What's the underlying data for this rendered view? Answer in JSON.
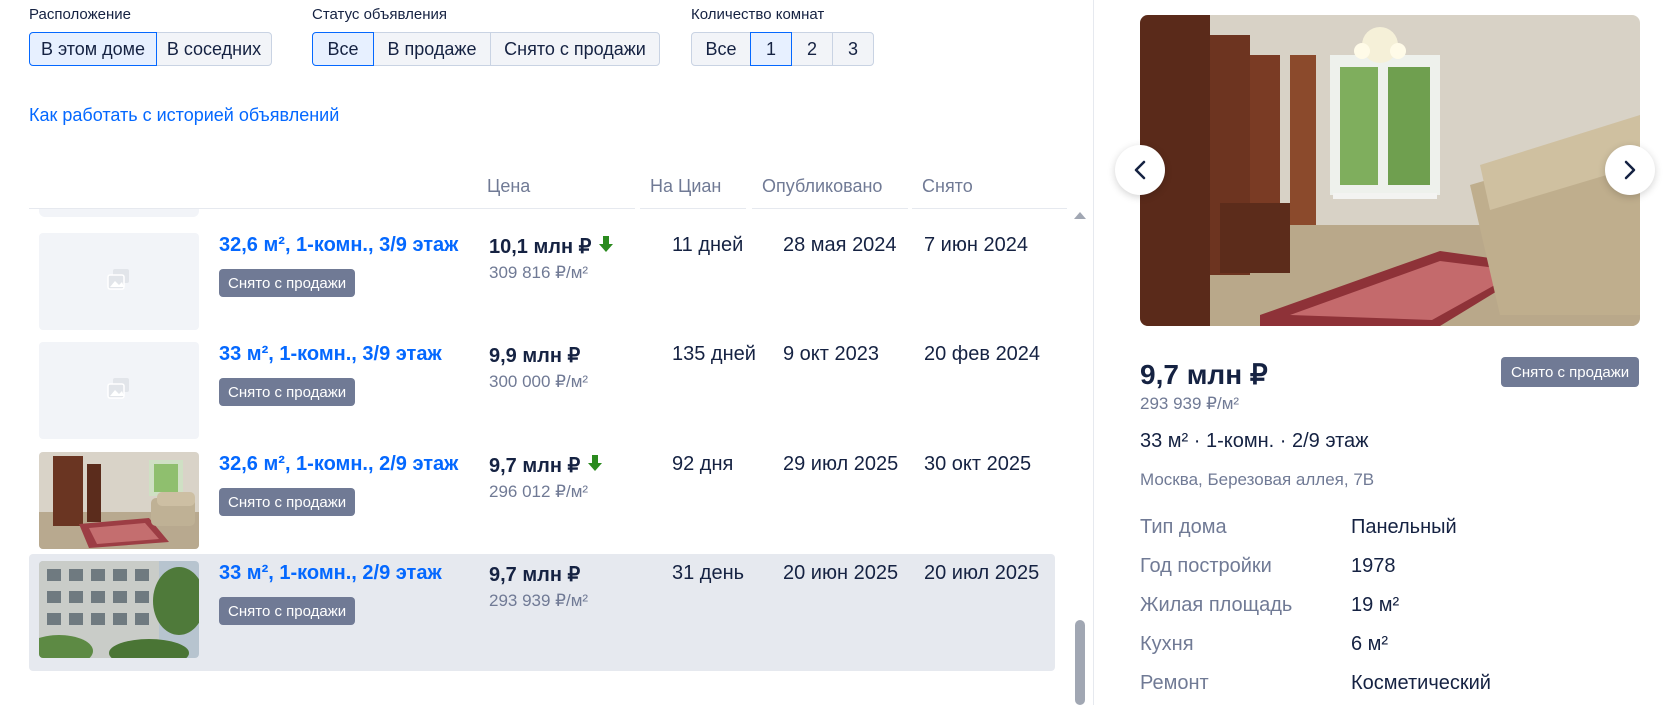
{
  "filters": {
    "location": {
      "label": "Расположение",
      "options": [
        "В этом доме",
        "В соседних"
      ]
    },
    "status": {
      "label": "Статус объявления",
      "options": [
        "Все",
        "В продаже",
        "Снято с продажи"
      ]
    },
    "rooms": {
      "label": "Количество комнат",
      "options": [
        "Все",
        "1",
        "2",
        "3"
      ]
    }
  },
  "howto_link": "Как работать с историей объявлений",
  "columns": {
    "price": "Цена",
    "on_cian": "На Циан",
    "published": "Опубликовано",
    "removed": "Снято"
  },
  "listings": [
    {
      "title": "32,6 м², 1-комн., 3/9 этаж",
      "badge": "Снято с продажи",
      "price": "10,1 млн ₽",
      "price_per_m2": "309 816 ₽/м²",
      "on_cian": "11 дней",
      "published": "28 мая 2024",
      "removed": "7 июн 2024",
      "price_down": true,
      "photo": "placeholder"
    },
    {
      "title": "33 м², 1-комн., 3/9 этаж",
      "badge": "Снято с продажи",
      "price": "9,9 млн ₽",
      "price_per_m2": "300 000 ₽/м²",
      "on_cian": "135 дней",
      "published": "9 окт 2023",
      "removed": "20 фев 2024",
      "price_down": false,
      "photo": "placeholder"
    },
    {
      "title": "32,6 м², 1-комн., 2/9 этаж",
      "badge": "Снято с продажи",
      "price": "9,7 млн ₽",
      "price_per_m2": "296 012 ₽/м²",
      "on_cian": "92 дня",
      "published": "29 июл 2025",
      "removed": "30 окт 2025",
      "price_down": true,
      "photo": "interior"
    },
    {
      "title": "33 м², 1-комн., 2/9 этаж",
      "badge": "Снято с продажи",
      "price": "9,7 млн ₽",
      "price_per_m2": "293 939 ₽/м²",
      "on_cian": "31 день",
      "published": "20 июн 2025",
      "removed": "20 июл 2025",
      "price_down": false,
      "photo": "building",
      "selected": true
    }
  ],
  "detail": {
    "price": "9,7 млн ₽",
    "badge": "Снято с продажи",
    "price_per_m2": "293 939 ₽/м²",
    "description": "33 м² · 1-комн. · 2/9 этаж",
    "address": "Москва, Березовая аллея, 7В",
    "specs": [
      {
        "key": "Тип дома",
        "value": "Панельный"
      },
      {
        "key": "Год постройки",
        "value": "1978"
      },
      {
        "key": "Жилая площадь",
        "value": "19 м²"
      },
      {
        "key": "Кухня",
        "value": "6 м²"
      },
      {
        "key": "Ремонт",
        "value": "Косметический"
      }
    ]
  },
  "colors": {
    "accent": "#0468ff",
    "badge": "#707a95",
    "down_arrow": "#2a8a1e",
    "text": "#152242"
  }
}
